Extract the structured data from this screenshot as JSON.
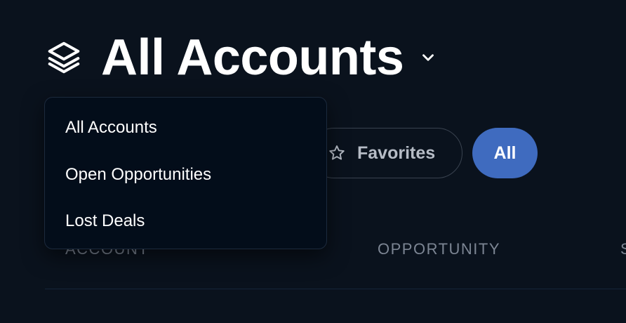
{
  "header": {
    "title": "All Accounts",
    "icon": "layers-icon",
    "dropdown_icon": "chevron-down-icon"
  },
  "dropdown": {
    "items": [
      {
        "label": "All Accounts"
      },
      {
        "label": "Open Opportunities"
      },
      {
        "label": "Lost Deals"
      }
    ]
  },
  "filters": {
    "favorites_label": "Favorites",
    "favorites_icon": "star-icon",
    "all_label": "All"
  },
  "table": {
    "columns": [
      "Account",
      "Opportunity",
      "S"
    ]
  },
  "colors": {
    "background": "#0a121d",
    "accent": "#3f6bbf",
    "dropdown_bg": "#030d1a",
    "muted_text": "#7c8593"
  }
}
